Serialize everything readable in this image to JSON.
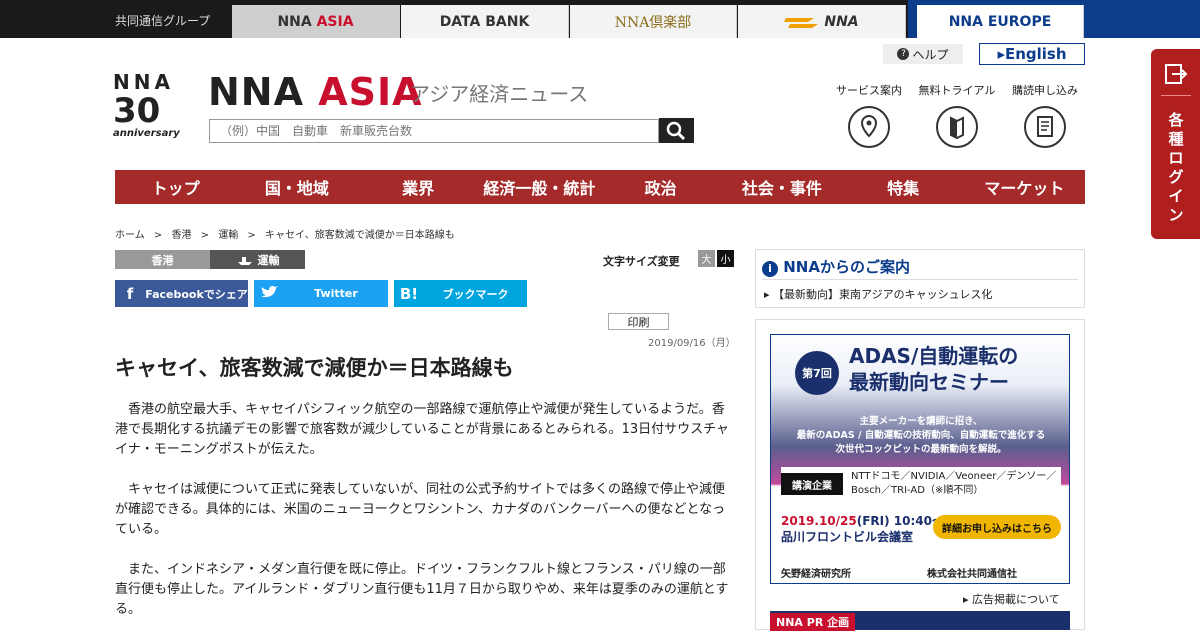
{
  "topbar": {
    "group": "共同通信グループ",
    "tabs": [
      {
        "label_a": "NNA",
        "label_b": "ASIA"
      },
      {
        "label_a": "DATA BANK",
        "label_b": ""
      },
      {
        "label_a": "NNA倶楽部",
        "label_b": ""
      },
      {
        "label_a": "NNA",
        "label_b": ""
      },
      {
        "label_a": "NNA EUROPE",
        "label_b": ""
      }
    ]
  },
  "header": {
    "help": "ヘルプ",
    "english": "▸English",
    "logo_brand": "NNA",
    "logo_number": "30",
    "logo_tagline": "anniversary",
    "brand_a": "NNA",
    "brand_b": "ASIA",
    "brand_sub": "アジア経済ニュース",
    "search_placeholder": "（例）中国　自動車　新車販売台数",
    "services": [
      {
        "label": "サービス案内",
        "icon": "map-pin-icon"
      },
      {
        "label": "無料トライアル",
        "icon": "book-icon"
      },
      {
        "label": "購読申し込み",
        "icon": "document-icon"
      }
    ]
  },
  "nav": [
    "トップ",
    "国・地域",
    "業界",
    "経済一般・統計",
    "政治",
    "社会・事件",
    "特集",
    "マーケット"
  ],
  "breadcrumb": [
    "ホーム",
    ">",
    "香港",
    ">",
    "運輸",
    ">",
    "キャセイ、旅客数減で減便か＝日本路線も"
  ],
  "article": {
    "categories": [
      "香港",
      "運輸"
    ],
    "font_size_label": "文字サイズ変更",
    "font_large": "大",
    "font_small": "小",
    "share": [
      {
        "icon": "f",
        "label": "Facebookでシェア",
        "color": "#3b5998"
      },
      {
        "icon": "🐦",
        "label": "Twitter",
        "color": "#1da1f2"
      },
      {
        "icon": "B!",
        "label": "ブックマーク",
        "color": "#00a4de"
      }
    ],
    "print": "印刷",
    "date": "2019/09/16（月）",
    "title": "キャセイ、旅客数減で減便か＝日本路線も",
    "paragraphs": [
      "香港の航空最大手、キャセイパシフィック航空の一部路線で運航停止や減便が発生しているようだ。香港で長期化する抗議デモの影響で旅客数が減少していることが背景にあるとみられる。13日付サウスチャイナ・モーニングポストが伝えた。",
      "キャセイは減便について正式に発表していないが、同社の公式予約サイトでは多くの路線で停止や減便が確認できる。具体的には、米国のニューヨークとワシントン、カナダのバンクーバーへの便などとなっている。",
      "また、インドネシア・メダン直行便を既に停止。ドイツ・フランクフルト線とフランス・パリ線の一部直行便も停止した。アイルランド・ダブリン直行便も11月７日から取りやめ、来年は夏季のみの運航とする。"
    ]
  },
  "sidebar": {
    "info_title": "NNAからのご案内",
    "info_item": "▸ 【最新動向】東南アジアのキャッシュレス化",
    "ad": {
      "badge": "第7回",
      "title_1": "ADAS/自動運転の",
      "title_2": "最新動向セミナー",
      "desc_1": "主要メーカーを講師に招き、",
      "desc_2": "最新のADAS / 自動運転の技術動向、自動運転で進化する",
      "desc_3": "次世代コックピットの最新動向を解説。",
      "speaker_key": "講演企業",
      "speakers_1": "NTTドコモ／NVIDIA／Veoneer／デンソー／",
      "speakers_2": "Bosch／TRI-AD（※順不同）",
      "date_year": "2019.10/25",
      "date_rest": "(FRI) 10:40～",
      "venue": "品川フロントビル会議室",
      "cta": "詳細お申し込みはこちら",
      "footer_left": "矢野経済研究所",
      "footer_right": "株式会社共同通信社"
    },
    "ad_note": "▸ 広告掲載について",
    "pr_label": "NNA PR 企画"
  },
  "login": {
    "label": "各種ログイン"
  }
}
